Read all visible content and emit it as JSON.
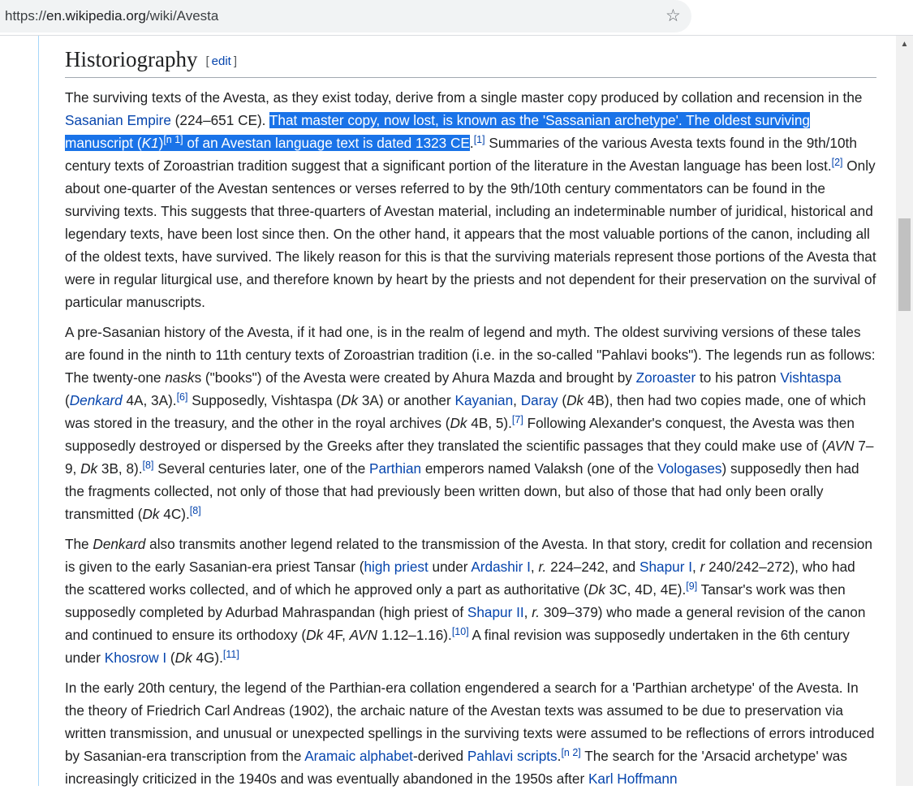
{
  "browser": {
    "url_scheme": "https://",
    "url_host": "en.wikipedia.org",
    "url_path": "/wiki/Avesta",
    "bookmark_icon": "star-icon"
  },
  "section": {
    "title": "Historiography",
    "edit": {
      "open": "[",
      "label": "edit",
      "close": "]"
    }
  },
  "p1": {
    "t1": "The surviving texts of the Avesta, as they exist today, derive from a single master copy produced by collation and recension in the ",
    "l1": "Sasanian Empire",
    "t2": " (224–651 CE). ",
    "sel1": "That master copy, now lost, is known as the 'Sassanian archetype'. The oldest surviving manuscript (",
    "sel_em": "K1",
    "sel2": ")",
    "sel_sup": "[n 1]",
    "sel3": " of an Avestan language text is dated 1323 CE",
    "t3": ".",
    "s1": "[1]",
    "t4": " Summaries of the various Avesta texts found in the 9th/10th century texts of Zoroastrian tradition suggest that a significant portion of the literature in the Avestan language has been lost.",
    "s2": "[2]",
    "t5": " Only about one-quarter of the Avestan sentences or verses referred to by the 9th/10th century commentators can be found in the surviving texts. This suggests that three-quarters of Avestan material, including an indeterminable number of juridical, historical and legendary texts, have been lost since then. On the other hand, it appears that the most valuable portions of the canon, including all of the oldest texts, have survived. The likely reason for this is that the surviving materials represent those portions of the Avesta that were in regular liturgical use, and therefore known by heart by the priests and not dependent for their preservation on the survival of particular manuscripts."
  },
  "p2": {
    "t1": "A pre-Sasanian history of the Avesta, if it had one, is in the realm of legend and myth. The oldest surviving versions of these tales are found in the ninth to 11th century texts of Zoroastrian tradition (i.e. in the so-called \"Pahlavi books\"). The legends run as follows: The twenty-one ",
    "e1": "nask",
    "t2": "s (\"books\") of the Avesta were created by Ahura Mazda and brought by ",
    "l1": "Zoroaster",
    "t3": " to his patron ",
    "l2": "Vishtaspa",
    "t4": " (",
    "l3": "Denkard",
    "t5": " 4A, 3A).",
    "s1": "[6]",
    "t6": " Supposedly, Vishtaspa (",
    "e2": "Dk",
    "t7": " 3A) or another ",
    "l4": "Kayanian",
    "t8": ", ",
    "l5": "Daray",
    "t9": " (",
    "e3": "Dk",
    "t10": " 4B), then had two copies made, one of which was stored in the treasury, and the other in the royal archives (",
    "e4": "Dk",
    "t11": " 4B, 5).",
    "s2": "[7]",
    "t12": " Following Alexander's conquest, the Avesta was then supposedly destroyed or dispersed by the Greeks after they translated the scientific passages that they could make use of (",
    "e5": "AVN",
    "t13": " 7–9, ",
    "e6": "Dk",
    "t14": " 3B, 8).",
    "s3": "[8]",
    "t15": " Several centuries later, one of the ",
    "l6": "Parthian",
    "t16": " emperors named Valaksh (one of the ",
    "l7": "Vologases",
    "t17": ") supposedly then had the fragments collected, not only of those that had previously been written down, but also of those that had only been orally transmitted (",
    "e7": "Dk",
    "t18": " 4C).",
    "s4": "[8]"
  },
  "p3": {
    "t1": "The ",
    "e1": "Denkard",
    "t2": " also transmits another legend related to the transmission of the Avesta. In that story, credit for collation and recension is given to the early Sasanian-era priest Tansar (",
    "l1": "high priest",
    "t3": " under ",
    "l2": "Ardashir I",
    "t4": ", ",
    "e2": "r.",
    "t5": " 224–242, and ",
    "l3": "Shapur I",
    "t6": ", ",
    "e3": "r",
    "t7": " 240/242–272), who had the scattered works collected, and of which he approved only a part as authoritative (",
    "e4": "Dk",
    "t8": " 3C, 4D, 4E).",
    "s1": "[9]",
    "t9": " Tansar's work was then supposedly completed by Adurbad Mahraspandan (high priest of ",
    "l4": "Shapur II",
    "t10": ", ",
    "e5": "r.",
    "t11": " 309–379) who made a general revision of the canon and continued to ensure its orthodoxy (",
    "e6": "Dk",
    "t12": " 4F, ",
    "e7": "AVN",
    "t13": " 1.12–1.16).",
    "s2": "[10]",
    "t14": " A final revision was supposedly undertaken in the 6th century under ",
    "l5": "Khosrow I",
    "t15": " (",
    "e8": "Dk",
    "t16": " 4G).",
    "s3": "[11]"
  },
  "p4": {
    "t1": "In the early 20th century, the legend of the Parthian-era collation engendered a search for a 'Parthian archetype' of the Avesta. In the theory of Friedrich Carl Andreas (1902), the archaic nature of the Avestan texts was assumed to be due to preservation via written transmission, and unusual or unexpected spellings in the surviving texts were assumed to be reflections of errors introduced by Sasanian-era transcription from the ",
    "l1": "Aramaic alphabet",
    "t2": "-derived ",
    "l2": "Pahlavi scripts",
    "t3": ".",
    "s1": "[n 2]",
    "t4": " The search for the 'Arsacid archetype' was increasingly criticized in the 1940s and was eventually abandoned in the 1950s after ",
    "l3": "Karl Hoffmann"
  },
  "scrollbar": {
    "up_arrow": "▲"
  },
  "colors": {
    "link": "#0645ad",
    "selection": "#1a73e8",
    "text": "#202122"
  }
}
